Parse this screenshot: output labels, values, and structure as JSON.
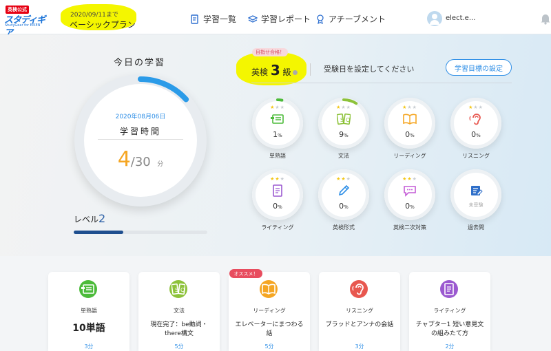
{
  "header": {
    "logo_badge": "英検公式",
    "logo_main": "スタディギア",
    "logo_sub": "StudyGear for EIKEN",
    "plan_date": "2020/09/11まで",
    "plan_name": "ベーシックプラン",
    "nav": [
      {
        "label": "学習一覧",
        "icon": "document-edit-icon"
      },
      {
        "label": "学習レポート",
        "icon": "layers-icon"
      },
      {
        "label": "アチーブメント",
        "icon": "medal-icon"
      }
    ],
    "user": "elect.e..."
  },
  "today": {
    "title": "今日の学習",
    "date": "2020年08月06日",
    "study_label": "学習時間",
    "time_value": "4",
    "time_sep": "/30",
    "time_unit": "分",
    "progress": 0.1333,
    "level_label": "レベル",
    "level_value": "2",
    "level_progress": 0.37
  },
  "goal": {
    "badge": "目指せ合格！",
    "grade_prefix": "英検",
    "grade_num": "3",
    "grade_suffix": "級",
    "exam_text": "受験日を設定してください",
    "button_label": "学習目標の設定"
  },
  "skills": [
    {
      "name": "単熟語",
      "stars": 1,
      "pct": "1",
      "unit": "%",
      "icon": "vocabulary-card-icon",
      "color": "#4cbb3a",
      "progress": 0.01
    },
    {
      "name": "文法",
      "stars": 1,
      "pct": "9",
      "unit": "%",
      "icon": "grammar-book-icon",
      "color": "#8dc23a",
      "progress": 0.09
    },
    {
      "name": "リーディング",
      "stars": 1,
      "pct": "0",
      "unit": "%",
      "icon": "open-book-icon",
      "color": "#f5a623",
      "progress": 0
    },
    {
      "name": "リスニング",
      "stars": 1,
      "pct": "0",
      "unit": "%",
      "icon": "ear-icon",
      "color": "#e8574f",
      "progress": 0
    },
    {
      "name": "ライティング",
      "stars": 2,
      "pct": "0",
      "unit": "%",
      "icon": "writing-sheet-icon",
      "color": "#9b59d0",
      "progress": 0
    },
    {
      "name": "英検形式",
      "stars": 2,
      "pct": "0",
      "unit": "%",
      "icon": "pencil-icon",
      "color": "#2d8ee6",
      "progress": 0
    },
    {
      "name": "英検二次対策",
      "stars": 2,
      "pct": "0",
      "unit": "%",
      "icon": "speech-bubble-icon",
      "color": "#c45bd6",
      "progress": 0
    },
    {
      "name": "過去問",
      "stars": 0,
      "pct": "未受験",
      "unit": "",
      "icon": "past-exam-icon",
      "color": "#2f6fc9",
      "progress": 0
    }
  ],
  "cards": [
    {
      "category": "単熟語",
      "body": "10単語",
      "minutes": "3分",
      "color": "#4cbb3a",
      "big": true
    },
    {
      "category": "文法",
      "body": "現在完了：be動詞・there構文",
      "minutes": "5分",
      "color": "#8dc23a",
      "big": false
    },
    {
      "category": "リーディング",
      "body": "エレベーターにまつわる話",
      "minutes": "5分",
      "color": "#f5a623",
      "big": false,
      "badge": "オススメ！"
    },
    {
      "category": "リスニング",
      "body": "ブラッドとアンナの会話",
      "minutes": "3分",
      "color": "#e8574f",
      "big": false
    },
    {
      "category": "ライティング",
      "body": "チャプター1 短い意見文の組みたて方",
      "minutes": "2分",
      "color": "#9b59d0",
      "big": false
    }
  ]
}
